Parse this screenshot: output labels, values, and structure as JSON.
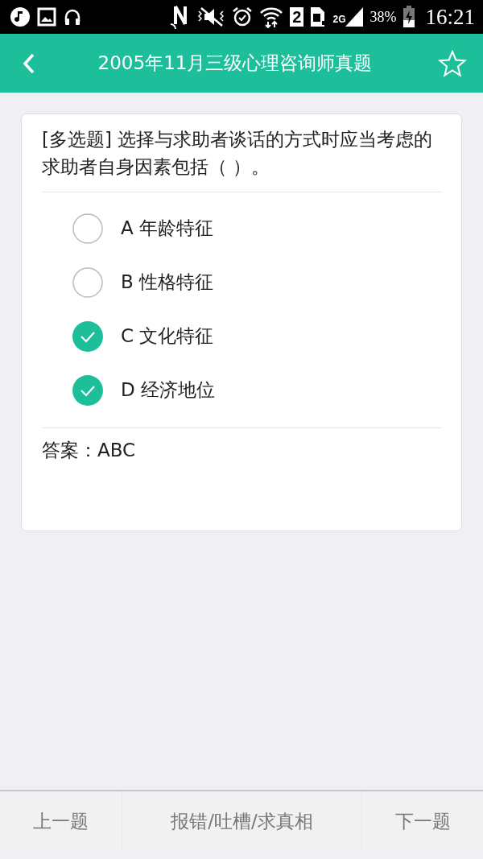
{
  "status_bar": {
    "sim_slot": "2",
    "network": "2G",
    "battery": "38%",
    "time": "16:21"
  },
  "header": {
    "title": "2005年11月三级心理咨询师真题",
    "favorite": false
  },
  "question": {
    "text": "[多选题] 选择与求助者谈话的方式时应当考虑的求助者自身因素包括（   ）。",
    "options": [
      {
        "label": "A 年龄特征",
        "selected": false
      },
      {
        "label": "B 性格特征",
        "selected": false
      },
      {
        "label": "C 文化特征",
        "selected": true
      },
      {
        "label": "D 经济地位",
        "selected": true
      }
    ],
    "answer": "答案：ABC"
  },
  "bottom_bar": [
    "上一题",
    "报错/吐槽/求真相",
    "下一题"
  ]
}
